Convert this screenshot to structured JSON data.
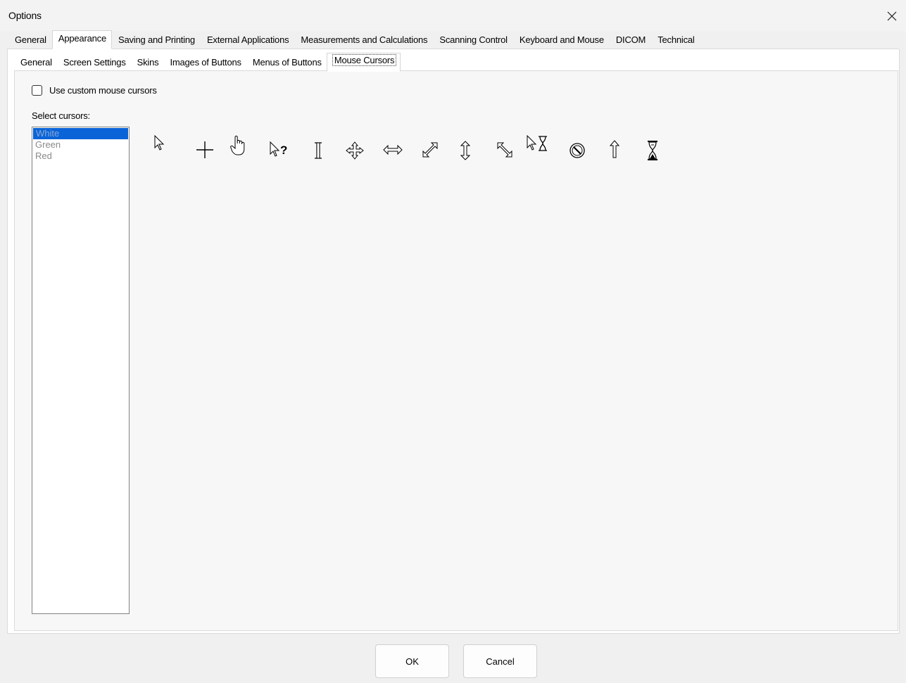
{
  "window": {
    "title": "Options"
  },
  "main_tabs": [
    {
      "label": "General"
    },
    {
      "label": "Appearance",
      "active": true
    },
    {
      "label": "Saving and Printing"
    },
    {
      "label": "External Applications"
    },
    {
      "label": "Measurements and Calculations"
    },
    {
      "label": "Scanning Control"
    },
    {
      "label": "Keyboard and Mouse"
    },
    {
      "label": "DICOM"
    },
    {
      "label": "Technical"
    }
  ],
  "sub_tabs": [
    {
      "label": "General"
    },
    {
      "label": "Screen Settings"
    },
    {
      "label": "Skins"
    },
    {
      "label": "Images of Buttons"
    },
    {
      "label": "Menus of Buttons"
    },
    {
      "label": "Mouse Cursors",
      "active": true
    }
  ],
  "custom_cursors": {
    "label": "Use custom mouse cursors",
    "checked": false
  },
  "select_label": "Select cursors:",
  "cursor_sets": [
    {
      "label": "White",
      "selected": true
    },
    {
      "label": "Green"
    },
    {
      "label": "Red"
    }
  ],
  "cursor_icons": [
    "arrow-cursor-icon",
    "crosshair-cursor-icon",
    "hand-cursor-icon",
    "help-cursor-icon",
    "ibeam-cursor-icon",
    "move-cursor-icon",
    "resize-horizontal-cursor-icon",
    "resize-diagonal-ne-cursor-icon",
    "resize-vertical-cursor-icon",
    "resize-diagonal-nw-cursor-icon",
    "app-starting-cursor-icon",
    "no-cursor-icon",
    "up-arrow-cursor-icon",
    "wait-cursor-icon"
  ],
  "buttons": {
    "ok": "OK",
    "cancel": "Cancel"
  }
}
